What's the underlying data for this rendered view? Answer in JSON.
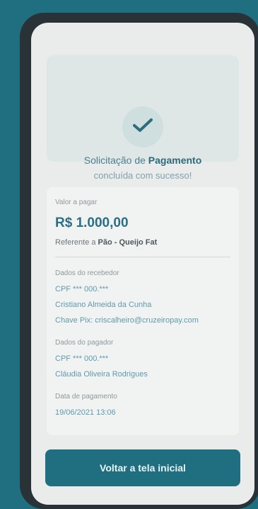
{
  "hero": {
    "title_prefix": "Solicitação de",
    "title_bold": "Pagamento",
    "subtitle": "concluída com sucesso!"
  },
  "summary": {
    "total_label": "Valor a pagar",
    "amount": "R$ 1.000,00",
    "reference_label": "Referente a",
    "reference_value": "Pão - Queijo Fat"
  },
  "sender": {
    "label": "Dados do recebedor",
    "cpf": "CPF *** 000.***",
    "name": "Cristiano Almeida da Cunha",
    "pix_key": "Chave Pix: criscalheiro@cruzeiropay.com"
  },
  "payer": {
    "label": "Dados do pagador",
    "cpf": "CPF *** 000.***",
    "name": "Cláudia Oliveira Rodrigues"
  },
  "schedule": {
    "label": "Data de pagamento",
    "value": "19/06/2021 13:06"
  },
  "actions": {
    "primary": "Voltar a tela inicial"
  },
  "colors": {
    "background": "#1f6f80",
    "accent": "#2a6f84"
  }
}
